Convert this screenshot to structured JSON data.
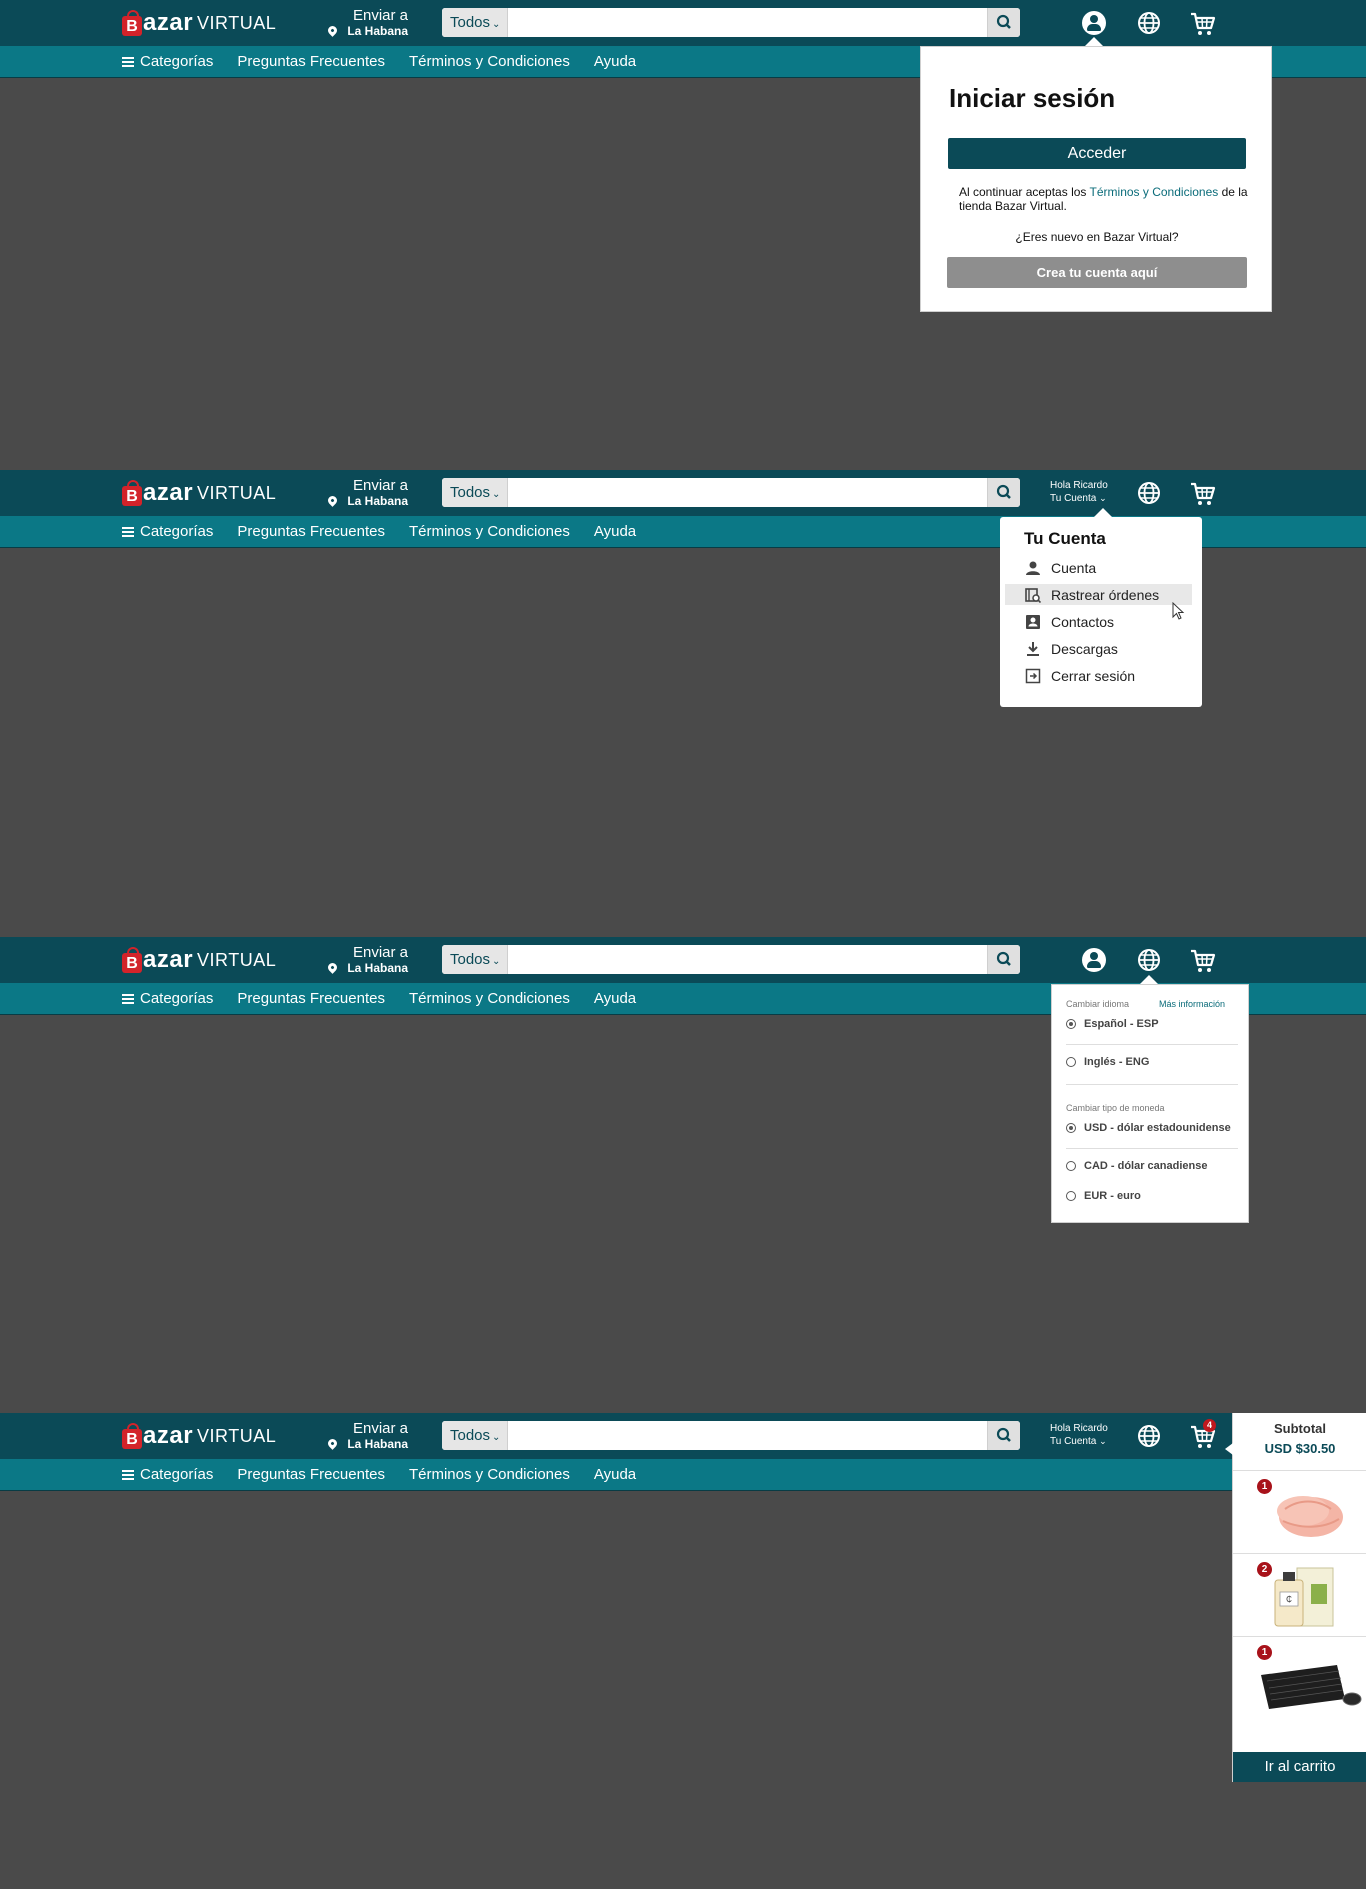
{
  "header": {
    "logo_b": "B",
    "logo_word1": "azar",
    "logo_word2": "VIRTUAL",
    "deliver_line1": "Enviar a",
    "deliver_line2": "La Habana",
    "search_category": "Todos",
    "search_placeholder": "",
    "greeting_line1": "Hola Ricardo",
    "greeting_line2": "Tu Cuenta"
  },
  "nav": {
    "categories": "Categorías",
    "faq": "Preguntas Frecuentes",
    "terms": "Términos y Condiciones",
    "help": "Ayuda"
  },
  "login_popup": {
    "title": "Iniciar sesión",
    "signin_button": "Acceder",
    "terms_prefix": "Al continuar aceptas los ",
    "terms_link": "Términos y Condiciones",
    "terms_suffix": " de la tienda Bazar Virtual.",
    "new_question": "¿Eres nuevo en Bazar Virtual?",
    "create_button": "Crea tu cuenta aquí"
  },
  "account_menu": {
    "title": "Tu Cuenta",
    "items": [
      {
        "label": "Cuenta",
        "icon": "person-icon"
      },
      {
        "label": "Rastrear órdenes",
        "icon": "track-orders-icon"
      },
      {
        "label": "Contactos",
        "icon": "contacts-icon"
      },
      {
        "label": "Descargas",
        "icon": "download-icon"
      },
      {
        "label": "Cerrar sesión",
        "icon": "logout-icon"
      }
    ],
    "hovered_index": 1
  },
  "language_menu": {
    "language_heading": "Cambiar idioma",
    "more_info": "Más información",
    "languages": [
      {
        "label": "Español - ESP",
        "selected": true
      },
      {
        "label": "Inglés - ENG",
        "selected": false
      }
    ],
    "currency_heading": "Cambiar tipo de moneda",
    "currencies": [
      {
        "label": "USD - dólar estadounidense",
        "selected": true
      },
      {
        "label": "CAD - dólar canadiense",
        "selected": false
      },
      {
        "label": "EUR - euro",
        "selected": false
      }
    ]
  },
  "cart": {
    "badge_count": "4",
    "subtotal_label": "Subtotal",
    "subtotal_amount": "USD $30.50",
    "items": [
      {
        "qty": "1",
        "image": "chicken-breast-image"
      },
      {
        "qty": "2",
        "image": "perfume-bottle-image"
      },
      {
        "qty": "1",
        "image": "keyboard-mouse-image"
      }
    ],
    "go_button": "Ir al carrito"
  },
  "colors": {
    "topbar": "#0b4a57",
    "navbar": "#0b7886",
    "overlay": "#4a4a4a",
    "brand_red": "#d3232a"
  }
}
